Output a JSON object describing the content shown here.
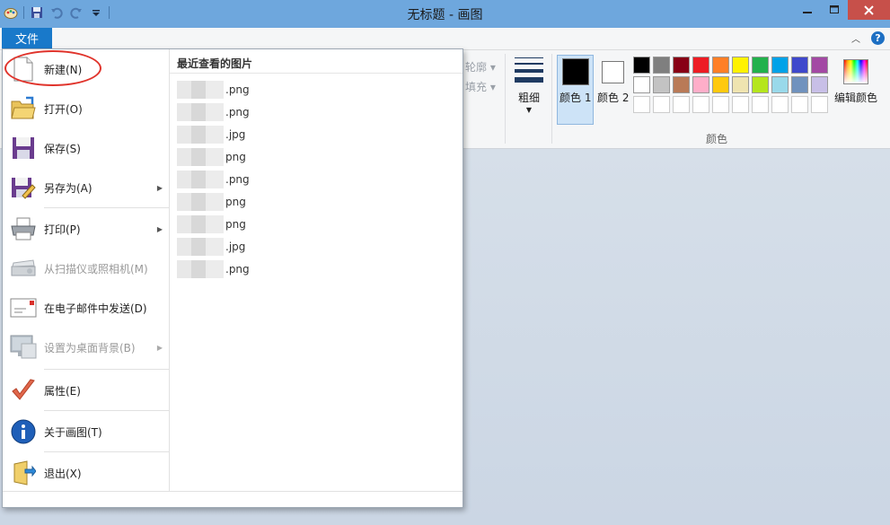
{
  "window": {
    "title": "无标题 - 画图"
  },
  "file_tab": {
    "label": "文件"
  },
  "menu": {
    "items": [
      {
        "id": "new",
        "label": "新建(N)",
        "icon": "new-document-icon",
        "enabled": true,
        "submenu": false
      },
      {
        "id": "open",
        "label": "打开(O)",
        "icon": "open-folder-icon",
        "enabled": true,
        "submenu": false
      },
      {
        "id": "save",
        "label": "保存(S)",
        "icon": "save-disk-icon",
        "enabled": true,
        "submenu": false
      },
      {
        "id": "save-as",
        "label": "另存为(A)",
        "icon": "save-as-icon",
        "enabled": true,
        "submenu": true
      },
      {
        "id": "print",
        "label": "打印(P)",
        "icon": "printer-icon",
        "enabled": true,
        "submenu": true
      },
      {
        "id": "scanner",
        "label": "从扫描仪或照相机(M)",
        "icon": "scanner-icon",
        "enabled": false,
        "submenu": false
      },
      {
        "id": "email",
        "label": "在电子邮件中发送(D)",
        "icon": "email-icon",
        "enabled": true,
        "submenu": false
      },
      {
        "id": "desktop-bg",
        "label": "设置为桌面背景(B)",
        "icon": "desktop-icon",
        "enabled": false,
        "submenu": true
      },
      {
        "id": "properties",
        "label": "属性(E)",
        "icon": "checkmark-icon",
        "enabled": true,
        "submenu": false
      },
      {
        "id": "about",
        "label": "关于画图(T)",
        "icon": "info-icon",
        "enabled": true,
        "submenu": false
      },
      {
        "id": "exit",
        "label": "退出(X)",
        "icon": "exit-icon",
        "enabled": true,
        "submenu": false
      }
    ],
    "recent_title": "最近查看的图片",
    "recent": [
      ".png",
      ".png",
      ".jpg",
      "png",
      ".png",
      "png",
      "png",
      ".jpg",
      ".png"
    ]
  },
  "ribbon": {
    "outline_label": "轮廓",
    "fill_label": "填充",
    "thickness_label": "粗细",
    "color1_label": "颜色 1",
    "color2_label": "颜色 2",
    "colors_group_label": "颜色",
    "edit_colors_label": "编辑颜色",
    "color1": "#000000",
    "color2": "#ffffff",
    "palette_row1": [
      "#000000",
      "#7f7f7f",
      "#880015",
      "#ed1c24",
      "#ff7f27",
      "#fff200",
      "#22b14c",
      "#00a2e8",
      "#3f48cc",
      "#a349a4"
    ],
    "palette_row2": [
      "#ffffff",
      "#c3c3c3",
      "#b97a57",
      "#ffaec9",
      "#ffc90e",
      "#efe4b0",
      "#b5e61d",
      "#99d9ea",
      "#7092be",
      "#c8bfe7"
    ]
  },
  "colors": {
    "title_bar": "#6ea7dd",
    "file_tab": "#1979ca",
    "close_button": "#c7504a",
    "highlight": "#e0332b"
  }
}
